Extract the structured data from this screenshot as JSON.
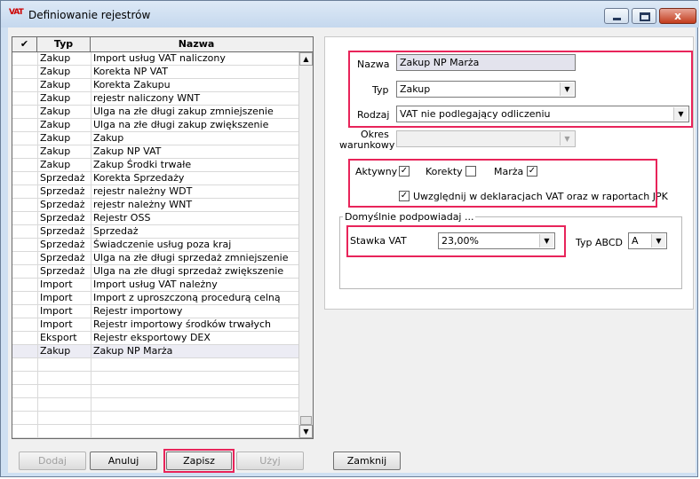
{
  "window": {
    "app_icon": "VAT",
    "title": "Definiowanie rejestrów",
    "close_glyph": "x"
  },
  "grid": {
    "columns": {
      "check": "✔",
      "typ": "Typ",
      "nazwa": "Nazwa"
    },
    "rows": [
      {
        "typ": "Zakup",
        "nazwa": "Import usług VAT naliczony"
      },
      {
        "typ": "Zakup",
        "nazwa": "Korekta NP VAT"
      },
      {
        "typ": "Zakup",
        "nazwa": "Korekta Zakupu"
      },
      {
        "typ": "Zakup",
        "nazwa": "rejestr naliczony WNT"
      },
      {
        "typ": "Zakup",
        "nazwa": "Ulga na złe długi zakup zmniejszenie"
      },
      {
        "typ": "Zakup",
        "nazwa": "Ulga na złe długi zakup zwiększenie"
      },
      {
        "typ": "Zakup",
        "nazwa": "Zakup"
      },
      {
        "typ": "Zakup",
        "nazwa": "Zakup NP VAT"
      },
      {
        "typ": "Zakup",
        "nazwa": "Zakup Środki trwałe"
      },
      {
        "typ": "Sprzedaż",
        "nazwa": "Korekta Sprzedaży"
      },
      {
        "typ": "Sprzedaż",
        "nazwa": "rejestr należny WDT"
      },
      {
        "typ": "Sprzedaż",
        "nazwa": "rejestr należny WNT"
      },
      {
        "typ": "Sprzedaż",
        "nazwa": "Rejestr OSS"
      },
      {
        "typ": "Sprzedaż",
        "nazwa": "Sprzedaż"
      },
      {
        "typ": "Sprzedaż",
        "nazwa": "Świadczenie usług poza kraj"
      },
      {
        "typ": "Sprzedaż",
        "nazwa": "Ulga na złe długi sprzedaż zmniejszenie"
      },
      {
        "typ": "Sprzedaż",
        "nazwa": "Ulga na złe długi sprzedaż zwiększenie"
      },
      {
        "typ": "Import",
        "nazwa": "Import usług VAT należny"
      },
      {
        "typ": "Import",
        "nazwa": "Import z uproszczoną procedurą celną"
      },
      {
        "typ": "Import",
        "nazwa": "Rejestr importowy"
      },
      {
        "typ": "Import",
        "nazwa": "Rejestr importowy środków trwałych"
      },
      {
        "typ": "Eksport",
        "nazwa": "Rejestr eksportowy DEX"
      },
      {
        "typ": "Zakup",
        "nazwa": "Zakup NP Marża"
      },
      {
        "typ": "",
        "nazwa": ""
      },
      {
        "typ": "",
        "nazwa": ""
      },
      {
        "typ": "",
        "nazwa": ""
      },
      {
        "typ": "",
        "nazwa": ""
      },
      {
        "typ": "",
        "nazwa": ""
      },
      {
        "typ": "",
        "nazwa": ""
      }
    ],
    "selected_index": 22,
    "scroll_up": "▲",
    "scroll_down": "▼"
  },
  "form": {
    "nazwa_label": "Nazwa",
    "nazwa_value": "Zakup NP Marża",
    "typ_label": "Typ",
    "typ_value": "Zakup",
    "rodzaj_label": "Rodzaj",
    "rodzaj_value": "VAT nie podlegający odliczeniu",
    "okres_label_1": "Okres",
    "okres_label_2": "warunkowy",
    "okres_value": "",
    "aktywny_label": "Aktywny",
    "aktywny_checked": "✓",
    "korekty_label": "Korekty",
    "korekty_checked": "",
    "marza_label": "Marża",
    "marza_checked": "✓",
    "uwzglednij_label": "Uwzględnij w deklaracjach VAT oraz w raportach JPK",
    "uwzglednij_checked": "✓",
    "group_title": "Domyślnie podpowiadaj ...",
    "stawka_label": "Stawka VAT",
    "stawka_value": "23,00%",
    "typ_abcd_label": "Typ ABCD",
    "typ_abcd_value": "A",
    "dropdown_arrow": "▼"
  },
  "buttons": {
    "dodaj": "Dodaj",
    "anuluj": "Anuluj",
    "zapisz": "Zapisz",
    "uzyj": "Użyj",
    "zamknij": "Zamknij"
  },
  "colors": {
    "highlight": "#e8245a",
    "window_frame": "#cfe0f2",
    "selected_row": "#ececf4"
  }
}
